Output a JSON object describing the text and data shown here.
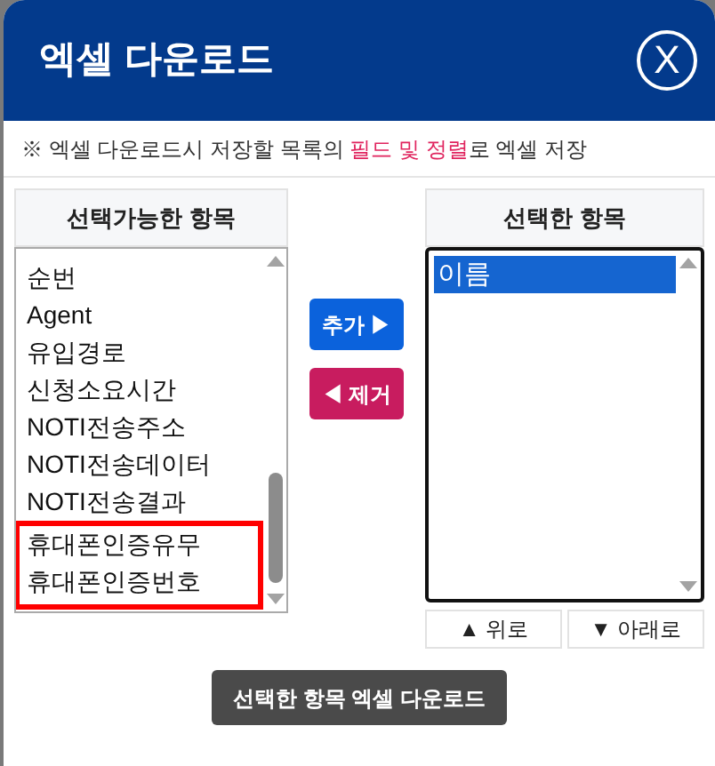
{
  "dialog": {
    "title": "엑셀 다운로드",
    "close_label": "X"
  },
  "notice": "※ 엑셀 다운로드시 저장할 목록의 **필드 및 정렬**로 엑셀 저장",
  "available": {
    "heading": "선택가능한 항목",
    "items": [
      {
        "label": "순번",
        "highlighted": false
      },
      {
        "label": "Agent",
        "highlighted": false
      },
      {
        "label": "유입경로",
        "highlighted": false
      },
      {
        "label": "신청소요시간",
        "highlighted": false
      },
      {
        "label": "NOTI전송주소",
        "highlighted": false
      },
      {
        "label": "NOTI전송데이터",
        "highlighted": false
      },
      {
        "label": "NOTI전송결과",
        "highlighted": false
      },
      {
        "label": "휴대폰인증유무",
        "highlighted": true
      },
      {
        "label": "휴대폰인증번호",
        "highlighted": true
      }
    ]
  },
  "add_button": "추가 ▶",
  "remove_button": "◀ 제거",
  "chosen": {
    "heading": "선택한 항목",
    "items": [
      {
        "label": "이름",
        "selected": true
      }
    ]
  },
  "up_button": "▲ 위로",
  "down_button": "▼ 아래로",
  "download_button": "선택한 항목 엑셀 다운로드"
}
